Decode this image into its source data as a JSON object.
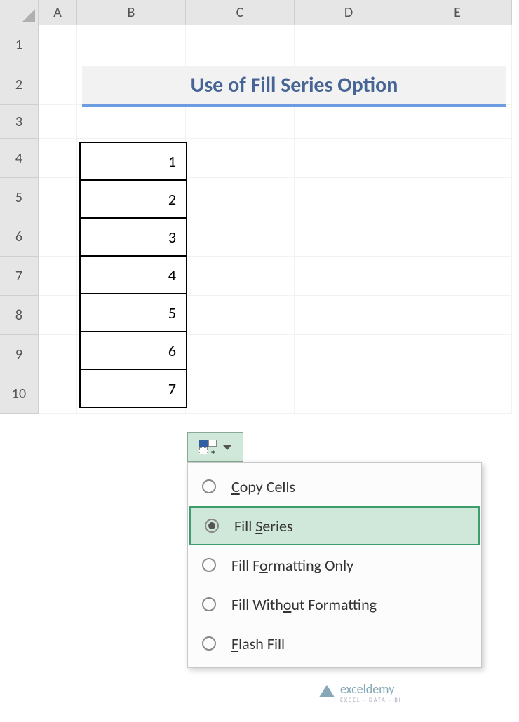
{
  "columns": [
    "A",
    "B",
    "C",
    "D",
    "E"
  ],
  "rows": [
    "1",
    "2",
    "3",
    "4",
    "5",
    "6",
    "7",
    "8",
    "9",
    "10"
  ],
  "title": "Use of Fill Series Option",
  "data_values": [
    "1",
    "2",
    "3",
    "4",
    "5",
    "6",
    "7"
  ],
  "menu": {
    "items": [
      {
        "label": "Copy Cells",
        "u": "C",
        "rest": "opy Cells",
        "selected": false
      },
      {
        "label": "Fill Series",
        "pre": "Fill ",
        "u": "S",
        "rest": "eries",
        "selected": true
      },
      {
        "label": "Fill Formatting Only",
        "pre": "Fill F",
        "u": "o",
        "rest": "rmatting Only",
        "selected": false
      },
      {
        "label": "Fill Without Formatting",
        "pre": "Fill With",
        "u": "o",
        "rest": "ut Formatting",
        "selected": false
      },
      {
        "label": "Flash Fill",
        "pre": "",
        "u": "F",
        "rest": "lash Fill",
        "selected": false
      }
    ]
  },
  "watermark": {
    "brand": "exceldemy",
    "tagline": "EXCEL · DATA · BI"
  }
}
